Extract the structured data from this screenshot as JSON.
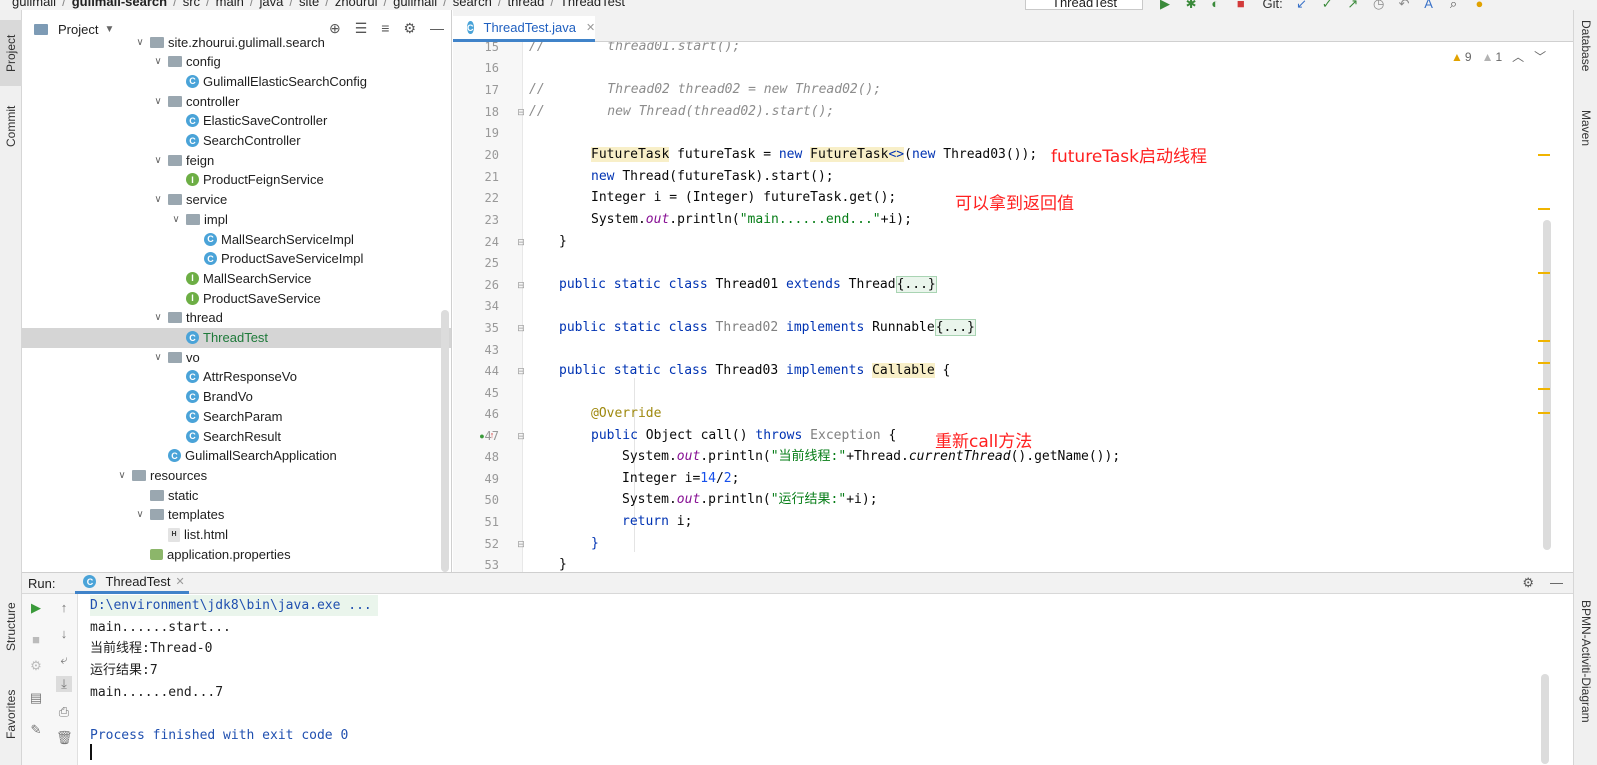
{
  "navbar": {
    "crumbs": [
      "gulimall",
      "gulimall-search",
      "src",
      "main",
      "java",
      "site",
      "zhourui",
      "gulimall",
      "search",
      "thread",
      "ThreadTest"
    ],
    "run_config": "ThreadTest",
    "git_label": "Git:"
  },
  "left_tabs": {
    "project": "Project",
    "commit": "Commit",
    "structure": "Structure",
    "favorites": "Favorites"
  },
  "right_tabs": {
    "database": "Database",
    "maven": "Maven",
    "bpmn": "BPMN-Activiti-Diagram"
  },
  "project_panel": {
    "title": "Project",
    "tree": [
      {
        "label": "site.zhourui.gulimall.search",
        "type": "folder",
        "depth": 0,
        "expanded": true
      },
      {
        "label": "config",
        "type": "folder",
        "depth": 1,
        "expanded": true
      },
      {
        "label": "GulimallElasticSearchConfig",
        "type": "class",
        "depth": 2
      },
      {
        "label": "controller",
        "type": "folder",
        "depth": 1,
        "expanded": true
      },
      {
        "label": "ElasticSaveController",
        "type": "class",
        "depth": 2
      },
      {
        "label": "SearchController",
        "type": "class",
        "depth": 2
      },
      {
        "label": "feign",
        "type": "folder",
        "depth": 1,
        "expanded": true
      },
      {
        "label": "ProductFeignService",
        "type": "interface",
        "depth": 2
      },
      {
        "label": "service",
        "type": "folder",
        "depth": 1,
        "expanded": true
      },
      {
        "label": "impl",
        "type": "folder",
        "depth": 2,
        "expanded": true
      },
      {
        "label": "MallSearchServiceImpl",
        "type": "class",
        "depth": 3
      },
      {
        "label": "ProductSaveServiceImpl",
        "type": "class",
        "depth": 3
      },
      {
        "label": "MallSearchService",
        "type": "interface",
        "depth": 2
      },
      {
        "label": "ProductSaveService",
        "type": "interface",
        "depth": 2
      },
      {
        "label": "thread",
        "type": "folder",
        "depth": 1,
        "expanded": true
      },
      {
        "label": "ThreadTest",
        "type": "class",
        "depth": 2,
        "selected": true
      },
      {
        "label": "vo",
        "type": "folder",
        "depth": 1,
        "expanded": true
      },
      {
        "label": "AttrResponseVo",
        "type": "class",
        "depth": 2
      },
      {
        "label": "BrandVo",
        "type": "class",
        "depth": 2
      },
      {
        "label": "SearchParam",
        "type": "class",
        "depth": 2
      },
      {
        "label": "SearchResult",
        "type": "class",
        "depth": 2
      },
      {
        "label": "GulimallSearchApplication",
        "type": "app",
        "depth": 1
      },
      {
        "label": "resources",
        "type": "folder",
        "depth": -1,
        "expanded": true
      },
      {
        "label": "static",
        "type": "folder",
        "depth": 0
      },
      {
        "label": "templates",
        "type": "folder",
        "depth": 0,
        "expanded": true
      },
      {
        "label": "list.html",
        "type": "html",
        "depth": 1
      },
      {
        "label": "application.properties",
        "type": "props",
        "depth": 0
      }
    ]
  },
  "editor": {
    "tab_label": "ThreadTest.java",
    "inspections": {
      "warnings": "9",
      "weak_warnings": "1"
    },
    "line_numbers": [
      "15",
      "16",
      "17",
      "18",
      "19",
      "20",
      "21",
      "22",
      "23",
      "24",
      "25",
      "26",
      "34",
      "35",
      "43",
      "44",
      "45",
      "46",
      "47",
      "48",
      "49",
      "50",
      "51",
      "52",
      "53"
    ],
    "annotations": {
      "futuretask": "futureTask启动线程",
      "return_value": "可以拿到返回值",
      "call": "重新call方法"
    },
    "code_tokens": {
      "l15": "//        thread01.start();",
      "l17": "//        Thread02 thread02 = new Thread02();",
      "l18": "//        new Thread(thread02).start();",
      "l20_a": "FutureTask",
      "l20_b": " futureTask = ",
      "l20_c": "new ",
      "l20_d": "FutureTask",
      "l20_e": "<>",
      "l20_f": "(",
      "l20_g": "new ",
      "l20_h": "Thread03());",
      "l21_a": "new ",
      "l21_b": "Thread(futureTask).start();",
      "l22": "Integer i = (Integer) futureTask.get();",
      "l23_a": "System.",
      "l23_b": "out",
      "l23_c": ".println(",
      "l23_d": "\"main......end...\"",
      "l23_e": "+i);",
      "l24": "}",
      "l26_a": "public static class ",
      "l26_b": "Thread01 ",
      "l26_c": "extends ",
      "l26_d": "Thread",
      "l26_e": "{...}",
      "l35_a": "public static class ",
      "l35_b": "Thread02 ",
      "l35_c": "implements ",
      "l35_d": "Runnable",
      "l35_e": "{...}",
      "l44_a": "public static class ",
      "l44_b": "Thread03 ",
      "l44_c": "implements ",
      "l44_d": "Callable",
      "l44_e": " {",
      "l46": "@Override",
      "l47_a": "public ",
      "l47_b": "Object call() ",
      "l47_c": "throws ",
      "l47_d": "Exception",
      "l47_e": " {",
      "l48_a": "System.",
      "l48_b": "out",
      "l48_c": ".println(",
      "l48_d": "\"当前线程:\"",
      "l48_e": "+Thread.",
      "l48_f": "currentThread",
      "l48_g": "().getName());",
      "l49_a": "Integer i=",
      "l49_b": "14",
      "l49_c": "/",
      "l49_d": "2",
      "l49_e": ";",
      "l50_a": "System.",
      "l50_b": "out",
      "l50_c": ".println(",
      "l50_d": "\"运行结果:\"",
      "l50_e": "+i);",
      "l51_a": "return ",
      "l51_b": "i;",
      "l52": "}",
      "l53": "}"
    }
  },
  "run_panel": {
    "label": "Run:",
    "tab_label": "ThreadTest",
    "output": [
      "D:\\environment\\jdk8\\bin\\java.exe ...",
      "main......start...",
      "当前线程:Thread-0",
      "运行结果:7",
      "main......end...7",
      "",
      "Process finished with exit code 0"
    ]
  }
}
